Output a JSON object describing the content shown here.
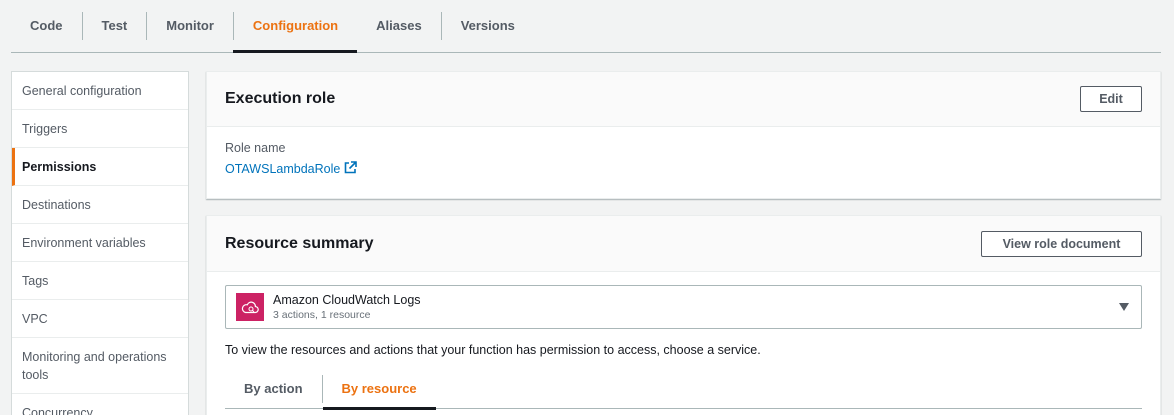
{
  "tabs": [
    "Code",
    "Test",
    "Monitor",
    "Configuration",
    "Aliases",
    "Versions"
  ],
  "active_tab": "Configuration",
  "sidenav": {
    "items": [
      "General configuration",
      "Triggers",
      "Permissions",
      "Destinations",
      "Environment variables",
      "Tags",
      "VPC",
      "Monitoring and operations tools",
      "Concurrency"
    ],
    "active": "Permissions"
  },
  "execution_role": {
    "title": "Execution role",
    "edit_label": "Edit",
    "role_name_label": "Role name",
    "role_name": "OTAWSLambdaRole"
  },
  "resource_summary": {
    "title": "Resource summary",
    "view_doc_label": "View role document",
    "service": {
      "name": "Amazon CloudWatch Logs",
      "detail": "3 actions, 1 resource",
      "icon": "cloudwatch-logs-icon"
    },
    "help_text": "To view the resources and actions that your function has permission to access, choose a service.",
    "subtabs": [
      "By action",
      "By resource"
    ],
    "active_subtab": "By resource"
  },
  "colors": {
    "accent": "#ec7211",
    "link": "#0073bb",
    "service_icon_bg": "#cc2264"
  }
}
